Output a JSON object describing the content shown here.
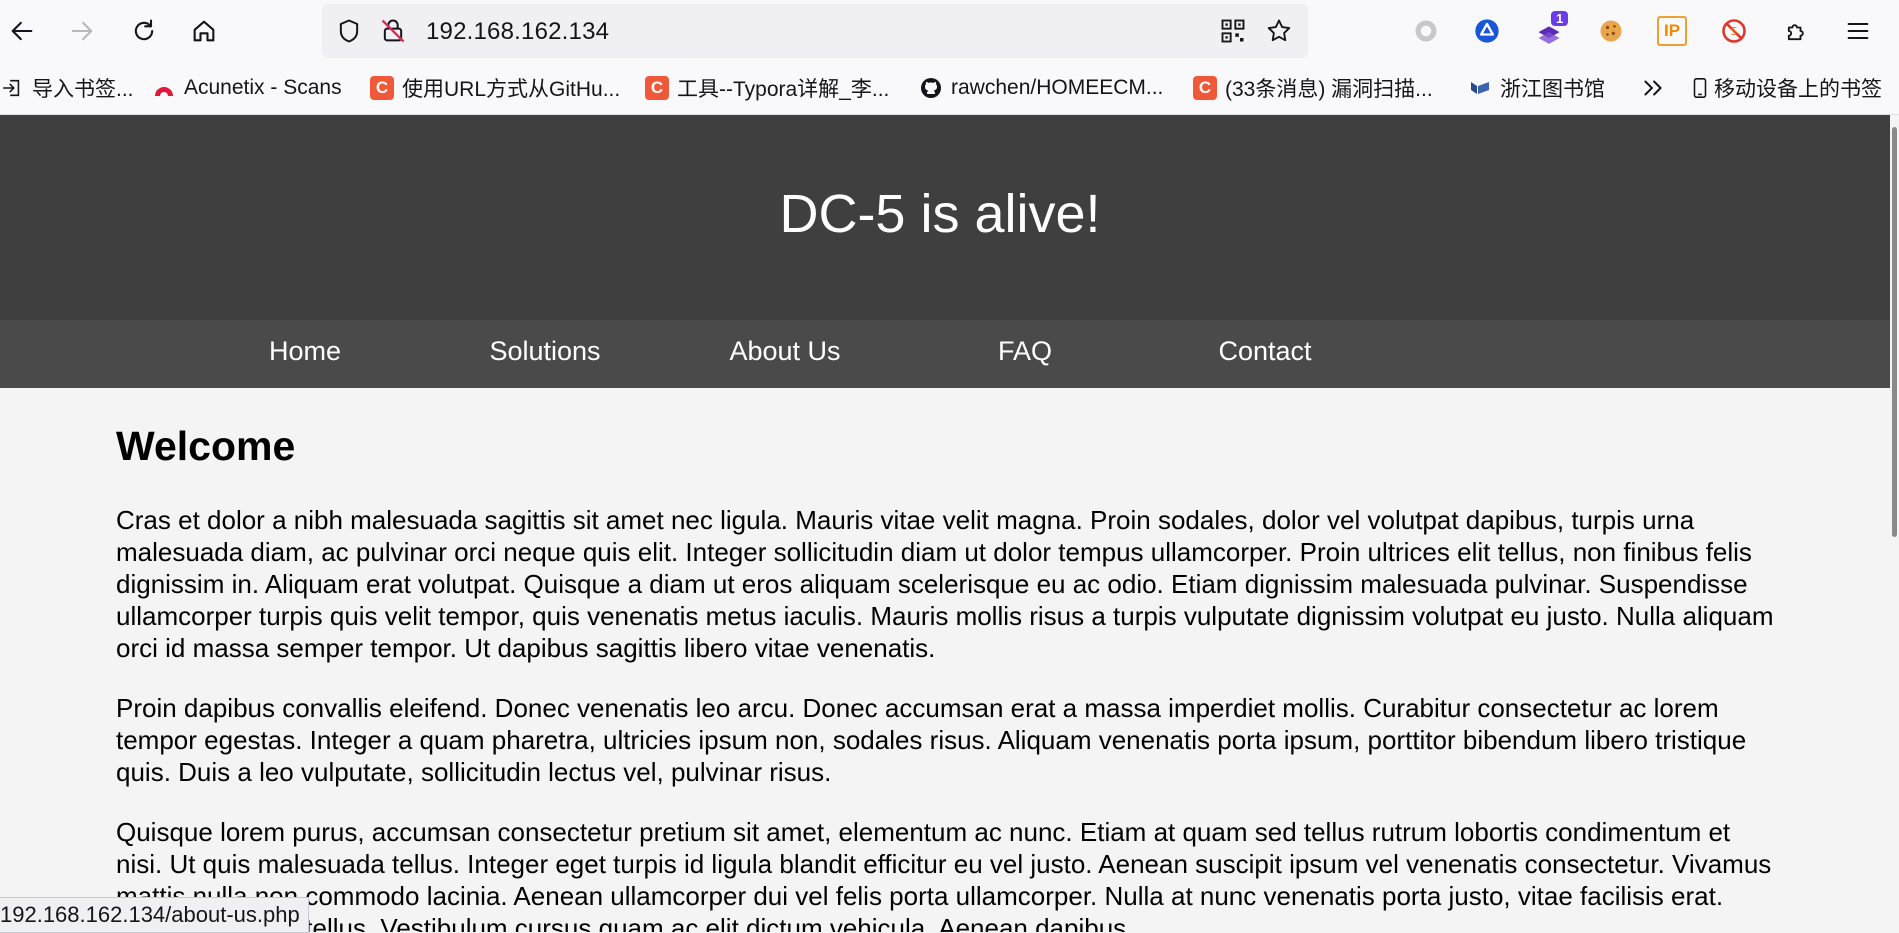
{
  "browser": {
    "url": "192.168.162.134",
    "extension_badge": "1",
    "ip_extension_label": "IP"
  },
  "bookmarks": [
    {
      "label": "导入书签...",
      "icon": "import-icon"
    },
    {
      "label": "Acunetix - Scans",
      "icon": "acunetix-icon"
    },
    {
      "label": "使用URL方式从GitHu...",
      "icon": "csdn-icon"
    },
    {
      "label": "工具--Typora详解_李...",
      "icon": "csdn-icon"
    },
    {
      "label": "rawchen/HOMEECM...",
      "icon": "github-icon"
    },
    {
      "label": "(33条消息) 漏洞扫描...",
      "icon": "csdn-icon"
    },
    {
      "label": "浙江图书馆",
      "icon": "library-icon"
    },
    {
      "label": "移动设备上的书签",
      "icon": "mobile-icon"
    }
  ],
  "csdn_favicon_letter": "C",
  "site": {
    "title": "DC-5 is alive!",
    "nav": [
      "Home",
      "Solutions",
      "About Us",
      "FAQ",
      "Contact"
    ],
    "heading": "Welcome",
    "paragraphs": [
      "Cras et dolor a nibh malesuada sagittis sit amet nec ligula. Mauris vitae velit magna. Proin sodales, dolor vel volutpat dapibus, turpis urna malesuada diam, ac pulvinar orci neque quis elit. Integer sollicitudin diam ut dolor tempus ullamcorper. Proin ultrices elit tellus, non finibus felis dignissim in. Aliquam erat volutpat. Quisque a diam ut eros aliquam scelerisque eu ac odio. Etiam dignissim malesuada pulvinar. Suspendisse ullamcorper turpis quis velit tempor, quis venenatis metus iaculis. Mauris mollis risus a turpis vulputate dignissim volutpat eu justo. Nulla aliquam orci id massa semper tempor. Ut dapibus sagittis libero vitae venenatis.",
      "Proin dapibus convallis eleifend. Donec venenatis leo arcu. Donec accumsan erat a massa imperdiet mollis. Curabitur consectetur ac lorem tempor egestas. Integer a quam pharetra, ultricies ipsum non, sodales risus. Aliquam venenatis porta ipsum, porttitor bibendum libero tristique quis. Duis a leo vulputate, sollicitudin lectus vel, pulvinar risus.",
      "Quisque lorem purus, accumsan consectetur pretium sit amet, elementum ac nunc. Etiam at quam sed tellus rutrum lobortis condimentum et nisi. Ut quis malesuada tellus. Integer eget turpis id ligula blandit efficitur eu vel justo. Aenean suscipit ipsum vel venenatis consectetur. Vivamus mattis nulla non commodo lacinia. Aenean ullamcorper dui vel felis porta ullamcorper. Nulla at nunc venenatis porta justo, vitae facilisis erat. Morbi ac rutrum tellus. Vestibulum cursus quam ac elit dictum vehicula. Aenean dapibus"
    ]
  },
  "status_url": "192.168.162.134/about-us.php",
  "colors": {
    "hero_bg": "#3f3f3f",
    "nav_bg": "#4a4a4a",
    "page_bg": "#f4f4f4",
    "csdn": "#f0583a"
  }
}
